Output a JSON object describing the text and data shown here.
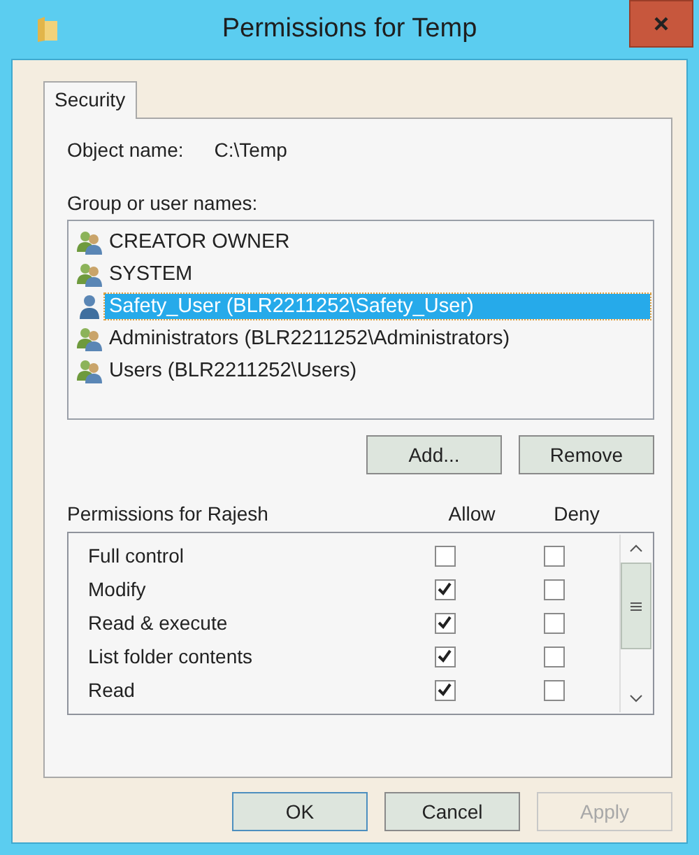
{
  "window": {
    "title": "Permissions for Temp"
  },
  "tabs": [
    {
      "label": "Security",
      "selected": true
    }
  ],
  "object_name": {
    "label": "Object name:",
    "value": "C:\\Temp"
  },
  "group_list": {
    "label": "Group or user names:",
    "items": [
      {
        "name": "CREATOR OWNER",
        "kind": "group",
        "selected": false
      },
      {
        "name": "SYSTEM",
        "kind": "group",
        "selected": false
      },
      {
        "name": "Safety_User (BLR2211252\\Safety_User)",
        "kind": "user",
        "selected": true
      },
      {
        "name": "Administrators (BLR2211252\\Administrators)",
        "kind": "group",
        "selected": false
      },
      {
        "name": "Users (BLR2211252\\Users)",
        "kind": "group",
        "selected": false
      }
    ]
  },
  "group_buttons": [
    "Add...",
    "Remove"
  ],
  "permissions": {
    "label": "Permissions for Rajesh",
    "columns": [
      "Allow",
      "Deny"
    ],
    "rows": [
      {
        "name": "Full control",
        "allow": false,
        "deny": false
      },
      {
        "name": "Modify",
        "allow": true,
        "deny": false
      },
      {
        "name": "Read & execute",
        "allow": true,
        "deny": false
      },
      {
        "name": "List folder contents",
        "allow": true,
        "deny": false
      },
      {
        "name": "Read",
        "allow": true,
        "deny": false
      }
    ]
  },
  "buttons": [
    {
      "label": "OK",
      "disabled": false,
      "default": true
    },
    {
      "label": "Cancel",
      "disabled": false,
      "default": false
    },
    {
      "label": "Apply",
      "disabled": true,
      "default": false
    }
  ]
}
